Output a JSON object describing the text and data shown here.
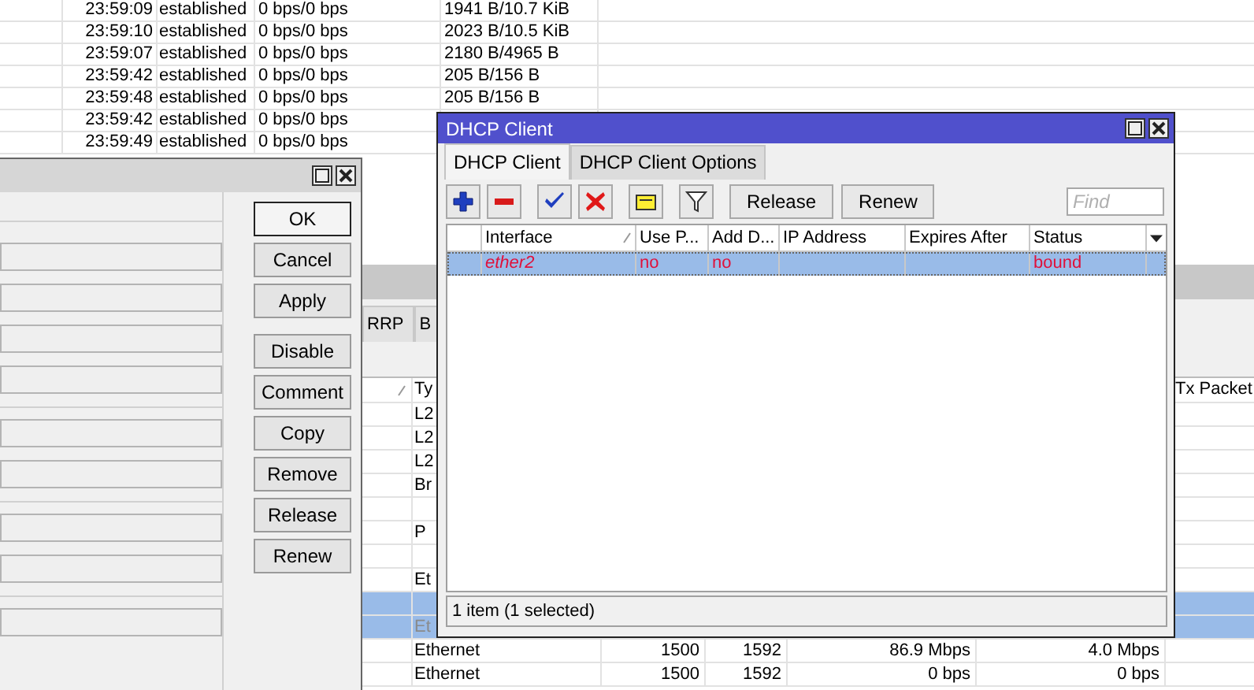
{
  "connections": {
    "rows": [
      {
        "time": "23:59:09",
        "state": "established",
        "rate": "0 bps/0 bps",
        "bytes": "1941 B/10.7 KiB"
      },
      {
        "time": "23:59:10",
        "state": "established",
        "rate": "0 bps/0 bps",
        "bytes": "2023 B/10.5 KiB"
      },
      {
        "time": "23:59:07",
        "state": "established",
        "rate": "0 bps/0 bps",
        "bytes": "2180 B/4965 B"
      },
      {
        "time": "23:59:42",
        "state": "established",
        "rate": "0 bps/0 bps",
        "bytes": "205 B/156 B"
      },
      {
        "time": "23:59:48",
        "state": "established",
        "rate": "0 bps/0 bps",
        "bytes": "205 B/156 B"
      },
      {
        "time": "23:59:42",
        "state": "established",
        "rate": "0 bps/0 bps"
      },
      {
        "time": "23:59:49",
        "state": "established",
        "rate": "0 bps/0 bps"
      }
    ]
  },
  "interface_window": {
    "tabs": [
      {
        "label": "RRP",
        "selected": false
      },
      {
        "label": "B",
        "selected": false
      }
    ],
    "columns": {
      "type": "Ty",
      "tx_packet": "Tx Packet"
    },
    "rows": [
      {
        "type": "L2",
        "selected": false,
        "disabled": false
      },
      {
        "type": "L2",
        "selected": false,
        "disabled": false
      },
      {
        "type": "L2",
        "selected": false,
        "disabled": false
      },
      {
        "type": "Br",
        "selected": false,
        "disabled": false
      },
      {
        "selected": false
      },
      {
        "type": "P",
        "selected": false,
        "disabled": false
      },
      {
        "selected": false
      },
      {
        "type": "Et",
        "selected": false,
        "disabled": false
      },
      {
        "selected": true,
        "disabled": false
      },
      {
        "type": "Et",
        "selected": true,
        "disabled": true
      },
      {
        "type": "Ethernet",
        "mtu": "1500",
        "l2mtu": "1592",
        "tx": "86.9 Mbps",
        "rx": "4.0 Mbps",
        "selected": false,
        "disabled": false
      },
      {
        "type": "Ethernet",
        "mtu": "1500",
        "l2mtu": "1592",
        "tx": "0 bps",
        "rx": "0 bps",
        "selected": false,
        "disabled": false
      }
    ]
  },
  "dialog": {
    "button_groups": [
      [
        {
          "label": "OK",
          "default": true
        },
        {
          "label": "Cancel",
          "default": false
        },
        {
          "label": "Apply",
          "default": false
        }
      ],
      [
        {
          "label": "Disable",
          "default": false
        },
        {
          "label": "Comment",
          "default": false
        },
        {
          "label": "Copy",
          "default": false
        },
        {
          "label": "Remove",
          "default": false
        },
        {
          "label": "Release",
          "default": false
        },
        {
          "label": "Renew",
          "default": false
        }
      ]
    ]
  },
  "dhcp_window": {
    "title": "DHCP Client",
    "tabs": [
      {
        "label": "DHCP Client",
        "selected": true
      },
      {
        "label": "DHCP Client Options",
        "selected": false
      }
    ],
    "toolbar": [
      {
        "kind": "add"
      },
      {
        "kind": "remove"
      },
      {
        "kind": "enable"
      },
      {
        "kind": "disable"
      },
      {
        "kind": "comment"
      },
      {
        "kind": "filter"
      },
      {
        "kind": "text",
        "label": "Release"
      },
      {
        "kind": "text",
        "label": "Renew"
      }
    ],
    "find": {
      "placeholder": "Find"
    },
    "columns": [
      {
        "label": "Interface",
        "sorted": true
      },
      {
        "label": "Use P...",
        "sorted": false
      },
      {
        "label": "Add D...",
        "sorted": false
      },
      {
        "label": "IP Address",
        "sorted": false
      },
      {
        "label": "Expires After",
        "sorted": false
      },
      {
        "label": "Status",
        "sorted": false
      }
    ],
    "rows": [
      {
        "cells": [
          "ether2",
          "no",
          "no",
          "",
          "",
          "bound"
        ],
        "selected": true,
        "invalid": true
      }
    ],
    "status_bar": "1 item (1 selected)"
  }
}
